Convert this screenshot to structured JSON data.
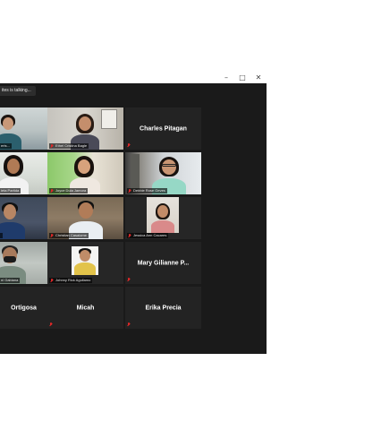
{
  "window": {
    "controls": {
      "minimize": "–",
      "maximize": "□",
      "close": "✕"
    }
  },
  "speaking": {
    "text": "ites is talking..."
  },
  "tiles": [
    {
      "name": "erts...",
      "muted": false
    },
    {
      "name": "Ethel Cristina Bagle",
      "muted": true
    },
    {
      "name": "Charles Pitagan",
      "muted": true
    },
    {
      "name": "ieta Partida",
      "muted": false
    },
    {
      "name": "Joyce Dula Jamora",
      "muted": true
    },
    {
      "name": "Debbie Rose Geves",
      "muted": true
    },
    {
      "name": "",
      "muted": false
    },
    {
      "name": "Christian Casalome",
      "muted": true
    },
    {
      "name": "Jessica Ann Cacares",
      "muted": true
    },
    {
      "name": "ni Gabiana",
      "muted": false
    },
    {
      "name": "Johnny Rick Agullamo",
      "muted": true
    },
    {
      "name": "Mary Gilianne P...",
      "muted": true
    },
    {
      "name": "Ortigosa",
      "muted": false
    },
    {
      "name": "Micah",
      "muted": true
    },
    {
      "name": "Erika Precia",
      "muted": true
    }
  ],
  "colors": {
    "background": "#1a1a1a",
    "tile": "#262626",
    "muted_mic": "#e02828"
  }
}
